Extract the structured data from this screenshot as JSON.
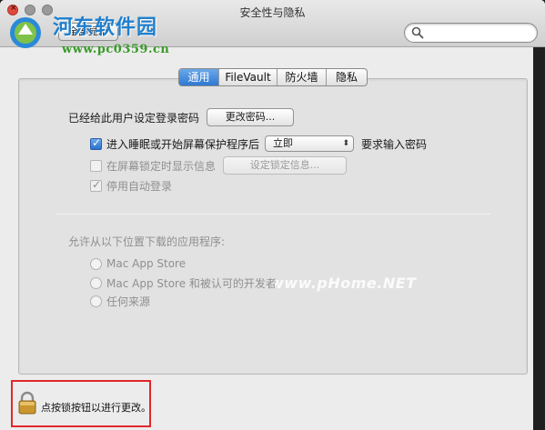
{
  "window": {
    "title": "安全性与隐私"
  },
  "watermarks": {
    "site_name": "河东软件园",
    "site_url": "www.pc0359.cn",
    "phome": "www.pHome.NET"
  },
  "toolbar": {
    "show_all_label": "全部显示"
  },
  "tabs": [
    {
      "label": "通用",
      "active": true
    },
    {
      "label": "FileVault",
      "active": false
    },
    {
      "label": "防火墙",
      "active": false
    },
    {
      "label": "隐私",
      "active": false
    }
  ],
  "general": {
    "password_set_text": "已经给此用户设定登录密码",
    "change_password_button": "更改密码...",
    "require_password": {
      "label": "进入睡眠或开始屏幕保护程序后",
      "checked": true,
      "delay_value": "立即",
      "suffix": "要求输入密码"
    },
    "show_message": {
      "label": "在屏幕锁定时显示信息",
      "checked": false,
      "button": "设定锁定信息..."
    },
    "disable_auto_login": {
      "label": "停用自动登录",
      "checked": true
    }
  },
  "downloads": {
    "heading": "允许从以下位置下载的应用程序:",
    "options": [
      {
        "label": "Mac App Store"
      },
      {
        "label": "Mac App Store 和被认可的开发者"
      },
      {
        "label": "任何来源"
      }
    ]
  },
  "lock": {
    "text": "点按锁按钮以进行更改。"
  },
  "colors": {
    "accent": "#3a86dd",
    "highlight_border": "#e3262b"
  }
}
